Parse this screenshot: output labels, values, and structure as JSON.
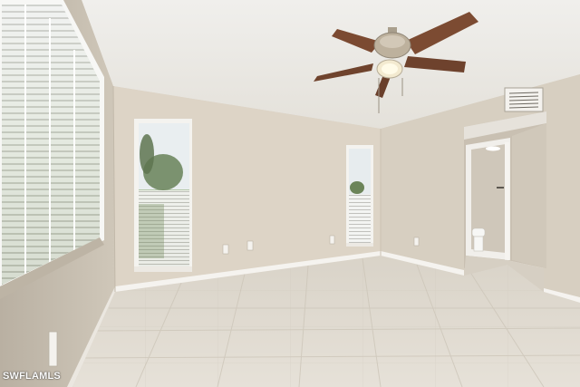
{
  "photo": {
    "subject": "empty-room-interior",
    "watermark_text": "SWFLAMLS"
  },
  "colors": {
    "wall_left": "#c9c0b1",
    "wall_back": "#ddd3c5",
    "wall_right": "#d9d1c4",
    "ceiling": "#ecebe6",
    "floor": "#ddd7cc",
    "baseboard": "#f4f2ee",
    "fan_blade": "#7a4a32",
    "fan_hub": "#b9ae9c"
  }
}
